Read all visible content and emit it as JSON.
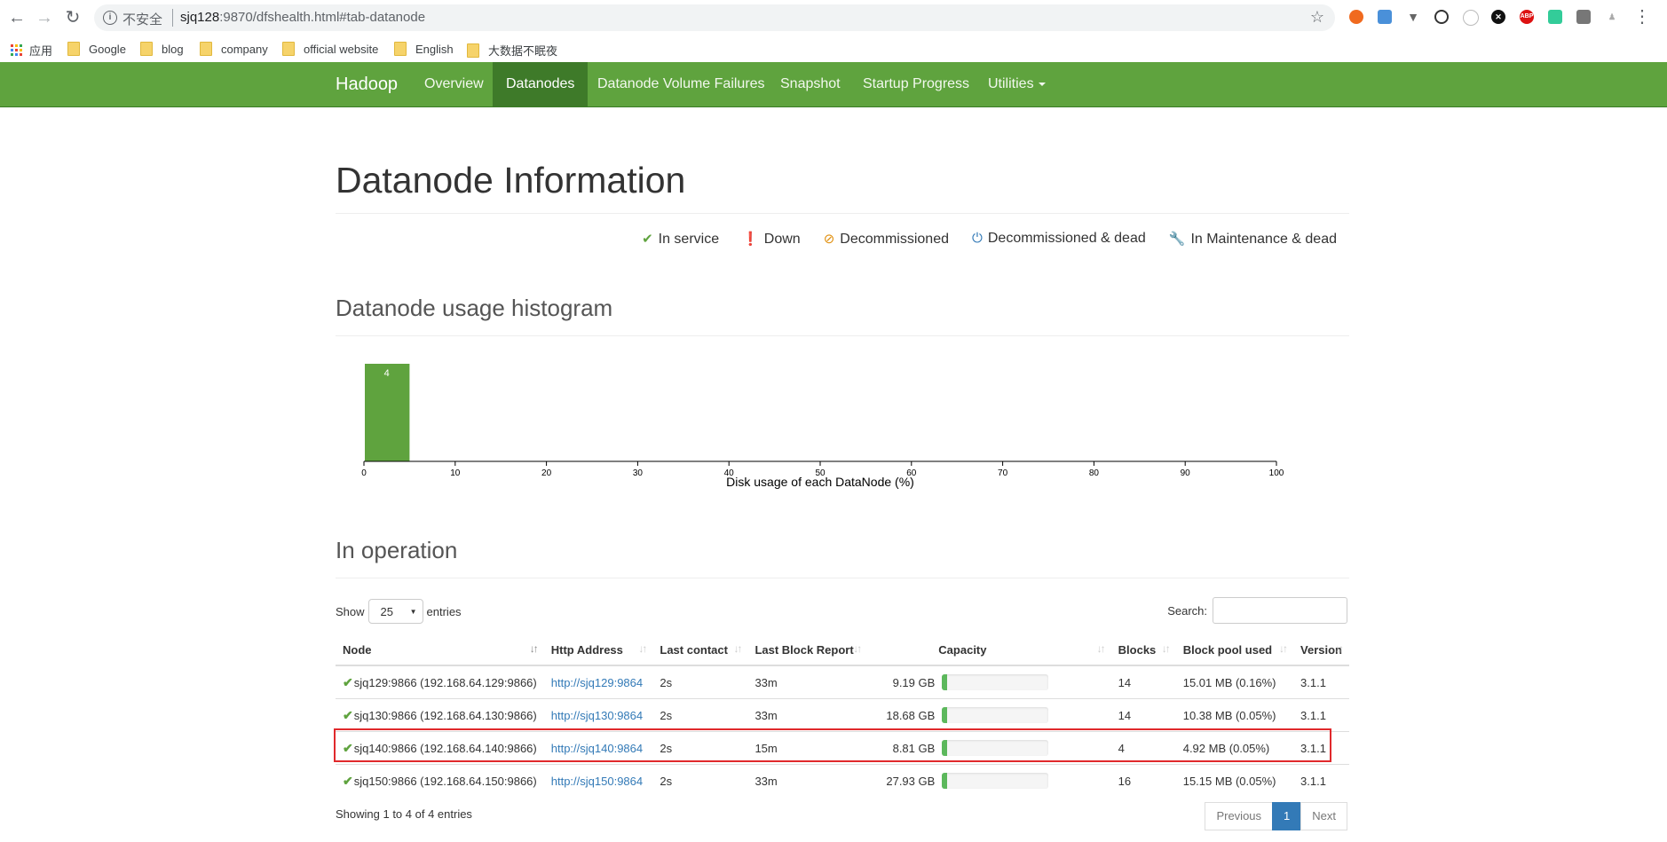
{
  "browser": {
    "insecure_label": "不安全",
    "url_host": "sjq128",
    "url_rest": ":9870/dfshealth.html#tab-datanode",
    "bookmarks": [
      "应用",
      "Google",
      "blog",
      "company",
      "official website",
      "English",
      "大数据不眠夜"
    ]
  },
  "navbar": {
    "brand": "Hadoop",
    "items": [
      "Overview",
      "Datanodes",
      "Datanode Volume Failures",
      "Snapshot",
      "Startup Progress",
      "Utilities"
    ],
    "active": "Datanodes"
  },
  "page": {
    "title": "Datanode Information",
    "legend": [
      "In service",
      "Down",
      "Decommissioned",
      "Decommissioned & dead",
      "In Maintenance & dead"
    ],
    "histogram_heading": "Datanode usage histogram",
    "operation_heading": "In operation"
  },
  "chart_data": {
    "type": "bar",
    "xlabel": "Disk usage of each DataNode (%)",
    "xlim": [
      0,
      100
    ],
    "x_ticks": [
      0,
      10,
      20,
      30,
      40,
      50,
      60,
      70,
      80,
      90,
      100
    ],
    "bins": [
      {
        "range": [
          0,
          5
        ],
        "count": 4
      }
    ]
  },
  "table": {
    "show_label": "Show",
    "entries_label": "entries",
    "page_size": "25",
    "search_label": "Search:",
    "columns": [
      "Node",
      "Http Address",
      "Last contact",
      "Last Block Report",
      "Capacity",
      "Blocks",
      "Block pool used",
      "Version"
    ],
    "rows": [
      {
        "node": "sjq129:9866 (192.168.64.129:9866)",
        "http": "http://sjq129:9864",
        "last_contact": "2s",
        "last_block_report": "33m",
        "capacity": "9.19 GB",
        "usage_fraction": 0.02,
        "blocks": "14",
        "block_pool_used": "15.01 MB (0.16%)",
        "version": "3.1.1"
      },
      {
        "node": "sjq130:9866 (192.168.64.130:9866)",
        "http": "http://sjq130:9864",
        "last_contact": "2s",
        "last_block_report": "33m",
        "capacity": "18.68 GB",
        "usage_fraction": 0.02,
        "blocks": "14",
        "block_pool_used": "10.38 MB (0.05%)",
        "version": "3.1.1"
      },
      {
        "node": "sjq140:9866 (192.168.64.140:9866)",
        "http": "http://sjq140:9864",
        "last_contact": "2s",
        "last_block_report": "15m",
        "capacity": "8.81 GB",
        "usage_fraction": 0.02,
        "blocks": "4",
        "block_pool_used": "4.92 MB (0.05%)",
        "version": "3.1.1"
      },
      {
        "node": "sjq150:9866 (192.168.64.150:9866)",
        "http": "http://sjq150:9864",
        "last_contact": "2s",
        "last_block_report": "33m",
        "capacity": "27.93 GB",
        "usage_fraction": 0.02,
        "blocks": "16",
        "block_pool_used": "15.15 MB (0.05%)",
        "version": "3.1.1"
      }
    ],
    "info": "Showing 1 to 4 of 4 entries",
    "pager": {
      "previous": "Previous",
      "current": "1",
      "next": "Next"
    }
  },
  "colors": {
    "navbar": "#5fa33e",
    "bar": "#5fa33e",
    "highlight": "#e0292c",
    "link": "#337ab7"
  }
}
